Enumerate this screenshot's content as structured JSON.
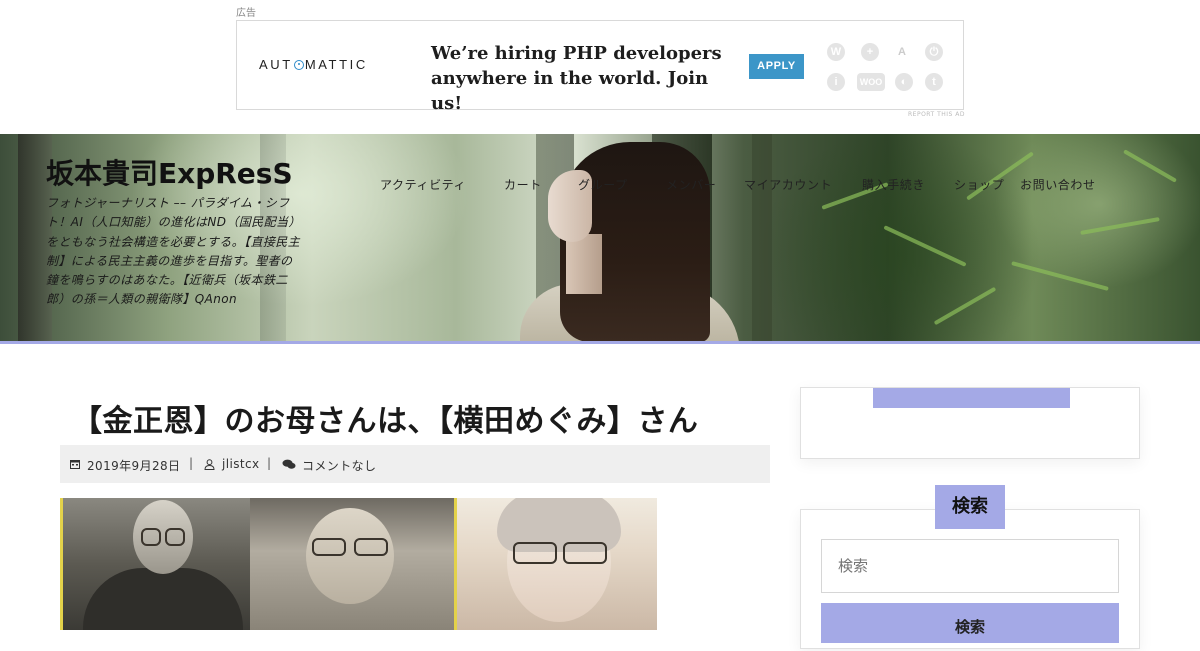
{
  "ad": {
    "label": "広告",
    "logo": "AUTOMATTIC",
    "headline": "We’re hiring PHP developers anywhere in the world. Join us!",
    "apply_label": "APPLY",
    "icons": [
      "wordpress-icon",
      "jetpack-icon",
      "akismet-icon",
      "power-icon",
      "info-icon",
      "woo-icon",
      "longreads-icon",
      "tumblr-icon"
    ],
    "woo_label": "WOO",
    "report": "REPORT THIS AD"
  },
  "header": {
    "site_title": "坂本貴司ExpResS",
    "description": "フォトジャーナリスト –– パラダイム・シフト！AI（人口知能）の進化はND（国民配当）をともなう社会構造を必要とする。【直接民主制】による民主主義の進歩を目指す。聖者の鐘を鳴らすのはあなた。【近衛兵（坂本鉄二郎）の孫＝人類の親衛隊】QAnon",
    "nav": [
      "アクティビティ",
      "カート",
      "グループ",
      "メンバー",
      "マイアカウント",
      "購入手続き",
      "ショップ",
      "お問い合わせ"
    ]
  },
  "post": {
    "title": "【金正恩】のお母さんは、【横田めぐみ】さん",
    "date": "2019年9月28日",
    "author": "jlistcx",
    "comments": "コメントなし"
  },
  "sidebar": {
    "search_title": "検索",
    "search_placeholder": "検索",
    "search_button": "検索"
  },
  "colors": {
    "accent": "#a4a9e6",
    "apply": "#3c96c8",
    "meta_bar": "#efefef"
  }
}
